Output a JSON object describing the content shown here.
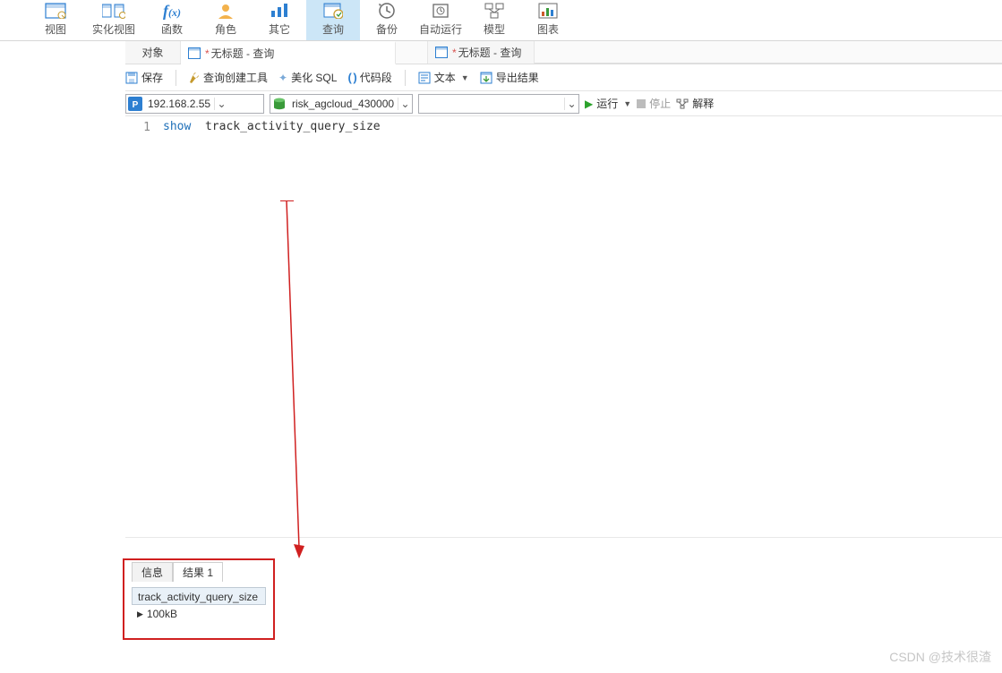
{
  "ribbon": {
    "view": "视图",
    "matview": "实化视图",
    "func": "函数",
    "role": "角色",
    "other": "其它",
    "query": "查询",
    "backup": "备份",
    "autorun": "自动运行",
    "model": "模型",
    "chart": "图表"
  },
  "tabs": {
    "objects": "对象",
    "q1": "无标题 - 查询",
    "q2": "无标题 - 查询"
  },
  "toolbar": {
    "save": "保存",
    "builder": "查询创建工具",
    "beautify": "美化 SQL",
    "snippet": "代码段",
    "text": "文本",
    "export": "导出结果"
  },
  "conn": {
    "host": "192.168.2.55",
    "db": "risk_agcloud_430000",
    "schema": ""
  },
  "actions": {
    "run": "运行",
    "stop": "停止",
    "explain": "解释"
  },
  "editor": {
    "line_no": "1",
    "keyword": "show",
    "rest": "track_activity_query_size"
  },
  "result": {
    "tab_info": "信息",
    "tab_result": "结果 1",
    "column": "track_activity_query_size",
    "value": "100kB"
  },
  "watermark": {
    "text": "CSDN @技术很渣"
  }
}
